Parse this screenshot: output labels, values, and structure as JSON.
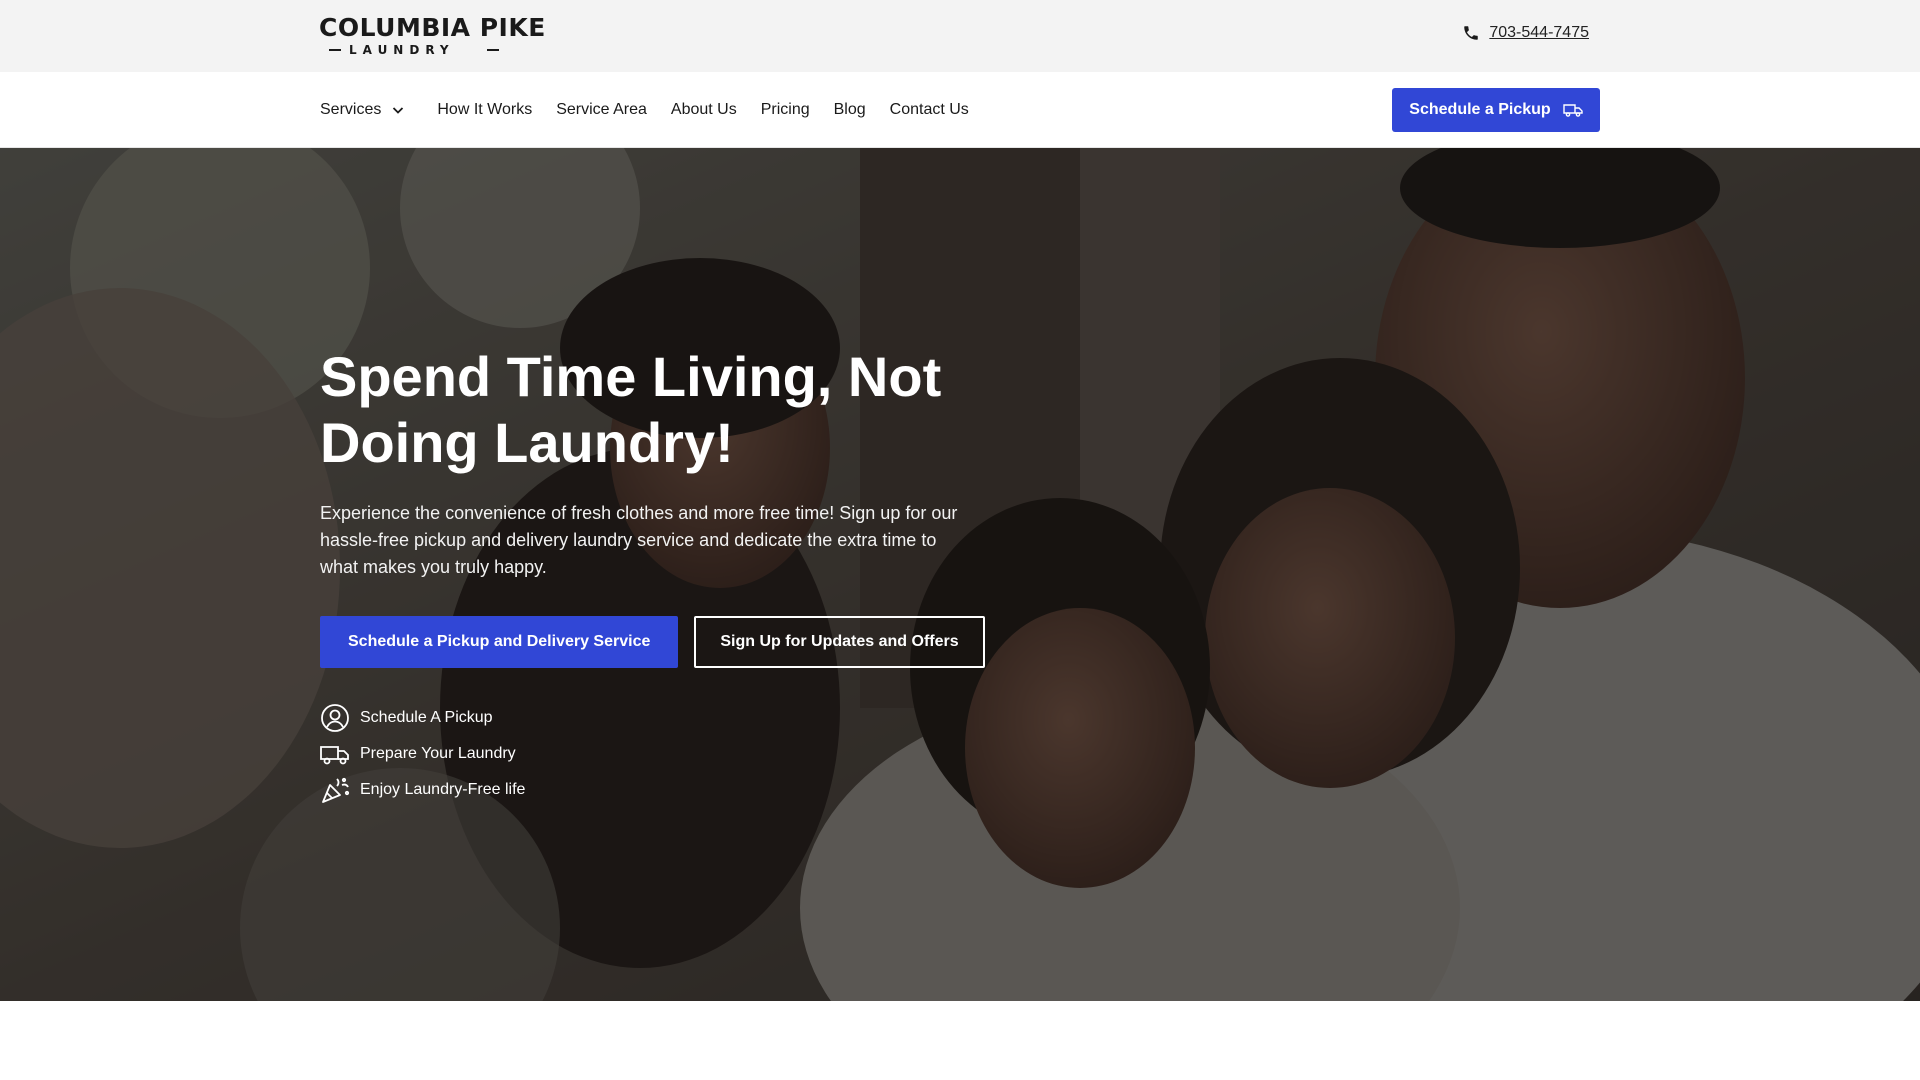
{
  "brand": {
    "logo_main": "COLUMBIA PIKE",
    "logo_sub": "LAUNDRY"
  },
  "contact": {
    "phone_icon": "phone-icon",
    "phone": "703-544-7475"
  },
  "nav": {
    "items": [
      {
        "label": "Services",
        "has_dropdown": true
      },
      {
        "label": "How It Works"
      },
      {
        "label": "Service Area"
      },
      {
        "label": "About Us"
      },
      {
        "label": "Pricing"
      },
      {
        "label": "Blog"
      },
      {
        "label": "Contact Us"
      }
    ],
    "cta_label": "Schedule a Pickup",
    "cta_icon": "delivery-truck-icon"
  },
  "hero": {
    "title": "Spend Time Living, Not Doing Laundry!",
    "text": "Experience the convenience of fresh clothes and more free time! Sign up for our hassle-free pickup and delivery laundry service and dedicate the extra time to what makes you truly happy.",
    "primary_button": "Schedule a Pickup and Delivery Service",
    "secondary_button": "Sign Up for Updates and Offers",
    "steps": [
      {
        "icon": "user-circle-icon",
        "label": "Schedule A Pickup"
      },
      {
        "icon": "delivery-truck-icon",
        "label": "Prepare Your Laundry"
      },
      {
        "icon": "party-popper-icon",
        "label": "Enjoy Laundry-Free life"
      }
    ]
  },
  "colors": {
    "accent": "#3147d6",
    "topbar_bg": "#f3f3f3",
    "hero_overlay": "#121212"
  }
}
